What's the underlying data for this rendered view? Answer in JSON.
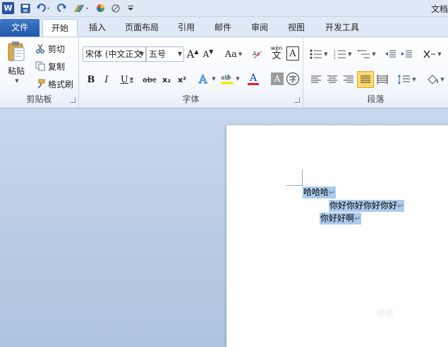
{
  "app": {
    "title": "文档"
  },
  "quick_access": {
    "logo": "W"
  },
  "tabs": [
    {
      "label": "文件"
    },
    {
      "label": "开始"
    },
    {
      "label": "插入"
    },
    {
      "label": "页面布局"
    },
    {
      "label": "引用"
    },
    {
      "label": "邮件"
    },
    {
      "label": "审阅"
    },
    {
      "label": "视图"
    },
    {
      "label": "开发工具"
    }
  ],
  "clipboard": {
    "paste_label": "粘贴",
    "cut_label": "剪切",
    "copy_label": "复制",
    "format_painter_label": "格式刷",
    "group_label": "剪贴板"
  },
  "font": {
    "font_name": "宋体 (中文正文",
    "font_size": "五号",
    "group_label": "字体",
    "bold": "B",
    "italic": "I",
    "underline": "U",
    "strike": "abc",
    "subscript": "x₂",
    "superscript": "x²",
    "grow": "A",
    "shrink": "A",
    "change_case": "Aa",
    "phonetic": "wén",
    "enclose": "字"
  },
  "paragraph": {
    "group_label": "段落"
  },
  "document": {
    "lines": [
      {
        "text": "哈哈哈"
      },
      {
        "text": "你好你好你好你好"
      },
      {
        "text": "你好好啊"
      }
    ],
    "paragraph_mark": "↵"
  },
  "watermark": "经验"
}
